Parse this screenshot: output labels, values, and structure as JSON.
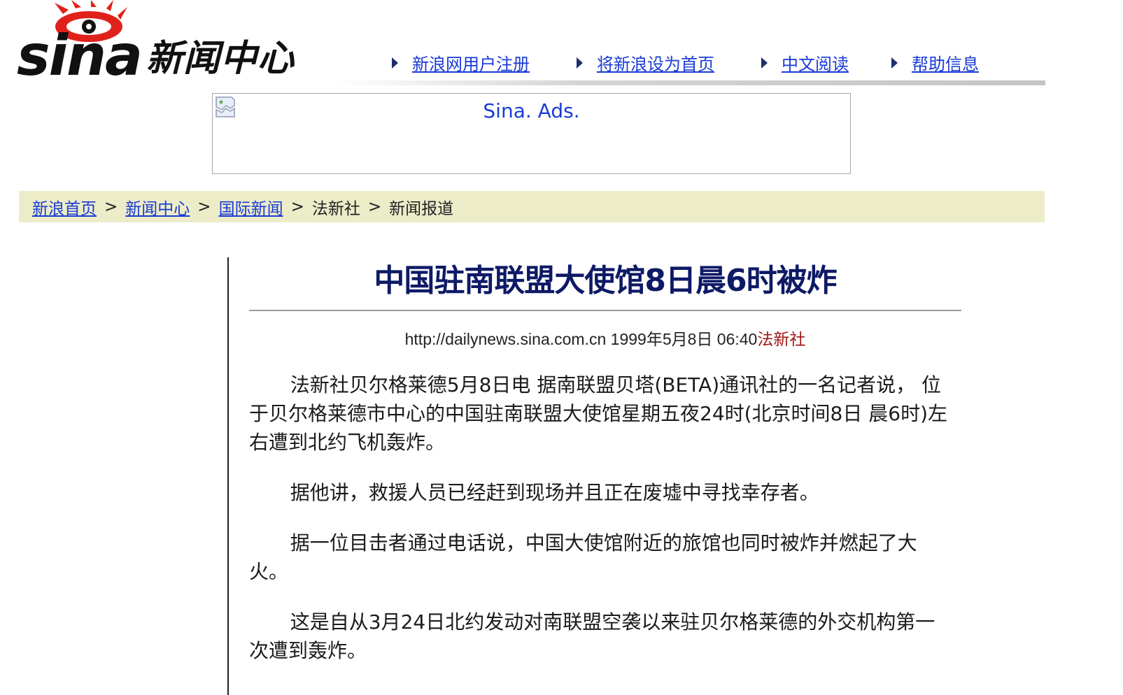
{
  "logo": {
    "wordmark": "sina",
    "subtitle": "新闻中心",
    "colors": {
      "eye": "#e0211b",
      "text": "#111111"
    }
  },
  "topnav": [
    {
      "label": "新浪网用户注册",
      "icon": "triangle-right-icon"
    },
    {
      "label": "将新浪设为首页",
      "icon": "triangle-right-icon"
    },
    {
      "label": "中文阅读",
      "icon": "triangle-right-icon"
    },
    {
      "label": "帮助信息",
      "icon": "triangle-right-icon"
    }
  ],
  "ad": {
    "alt_text": "Sina. Ads.",
    "icon": "broken-image-icon"
  },
  "breadcrumb": {
    "items": [
      {
        "label": "新浪首页",
        "link": true
      },
      {
        "label": "新闻中心",
        "link": true
      },
      {
        "label": "国际新闻",
        "link": true
      },
      {
        "label": "法新社",
        "link": false
      },
      {
        "label": "新闻报道",
        "link": false
      }
    ],
    "separator": ">"
  },
  "article": {
    "title": "中国驻南联盟大使馆8日晨6时被炸",
    "source_url": "http://dailynews.sina.com.cn",
    "date": "1999年5月8日 06:40",
    "source": "法新社",
    "paragraphs": [
      "法新社贝尔格莱德5月8日电 据南联盟贝塔(BETA)通讯社的一名记者说， 位于贝尔格莱德市中心的中国驻南联盟大使馆星期五夜24时(北京时间8日 晨6时)左右遭到北约飞机轰炸。",
      "据他讲，救援人员已经赶到现场并且正在废墟中寻找幸存者。",
      "据一位目击者通过电话说，中国大使馆附近的旅馆也同时被炸并燃起了大火。",
      "这是自从3月24日北约发动对南联盟空袭以来驻贝尔格莱德的外交机构第一次遭到轰炸。"
    ]
  },
  "colors": {
    "link": "#1a3bd6",
    "title": "#0e1a66",
    "source": "#a01818",
    "breadcrumb_bg": "#ececc9"
  }
}
